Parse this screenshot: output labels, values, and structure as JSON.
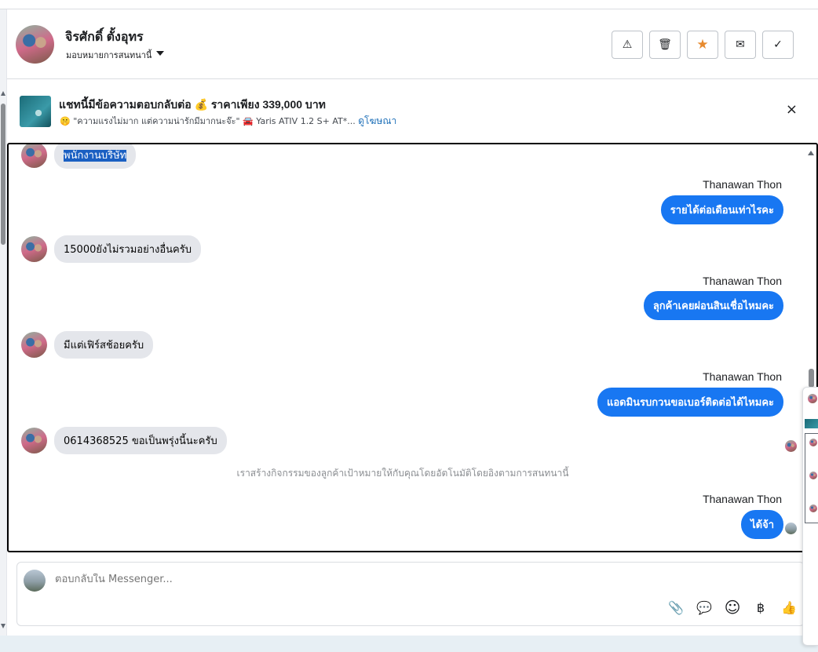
{
  "header": {
    "contact_name": "จิรศักดิ์ ตั้งอุทร",
    "assign_label": "มอบหมายการสนทนานี้",
    "actions": [
      {
        "name": "report-spam-button",
        "icon": "⚠"
      },
      {
        "name": "delete-button",
        "icon": "🗑"
      },
      {
        "name": "star-button",
        "icon": "★"
      },
      {
        "name": "mark-unread-button",
        "icon": "✉"
      },
      {
        "name": "mark-done-button",
        "icon": "✓"
      }
    ],
    "star_color": "#e78a2e"
  },
  "ad_banner": {
    "title": "แชทนี้มีข้อความตอบกลับต่อ 💰 ราคาเพียง 339,000 บาท",
    "subtitle": "🤫 \"ความแรงไม่มาก แต่ความน่ารักมีมากนะจ๊ะ\" 🚘 Yaris ATIV 1.2 S+ AT*...",
    "link": "ดูโฆษณา",
    "close_icon": "×"
  },
  "conversation": {
    "agent_name": "Thanawan Thon",
    "messages": [
      {
        "dir": "in",
        "text": "พนักงานบริษัท",
        "selected": true
      },
      {
        "dir": "out",
        "text": "รายได้ต่อเดือนเท่าไรคะ"
      },
      {
        "dir": "in",
        "text": "15000ยังไม่รวมอย่างอื่นครับ"
      },
      {
        "dir": "out",
        "text": "ลุกค้าเคยผ่อนสินเชื่อไหมคะ"
      },
      {
        "dir": "in",
        "text": "มีแต่เฟิร์สช้อยครับ"
      },
      {
        "dir": "out",
        "text": "แอดมินรบกวนขอเบอร์ติดต่อได้ไหมคะ"
      },
      {
        "dir": "in",
        "text": "0614368525 ขอเป็นพรุ่งนี้นะครับ"
      },
      {
        "dir": "out",
        "text": "ได้จ้า"
      }
    ],
    "system_note": "เราสร้างกิจกรรมของลูกค้าเป้าหมายให้กับคุณโดยอัตโนมัติโดยอิงตามการสนทนานี้"
  },
  "composer": {
    "placeholder": "ตอบกลับใน Messenger...",
    "tools": [
      {
        "name": "attach-icon",
        "glyph": "📎"
      },
      {
        "name": "saved-reply-icon",
        "glyph": "💬"
      },
      {
        "name": "emoji-icon",
        "glyph": "☺"
      },
      {
        "name": "baht-payment-icon",
        "glyph": "฿"
      },
      {
        "name": "thumbs-up-icon",
        "glyph": "👍"
      }
    ]
  },
  "colors": {
    "outgoing_bubble": "#1877f2",
    "incoming_bubble": "#e4e6eb",
    "link": "#1d6fb8"
  }
}
